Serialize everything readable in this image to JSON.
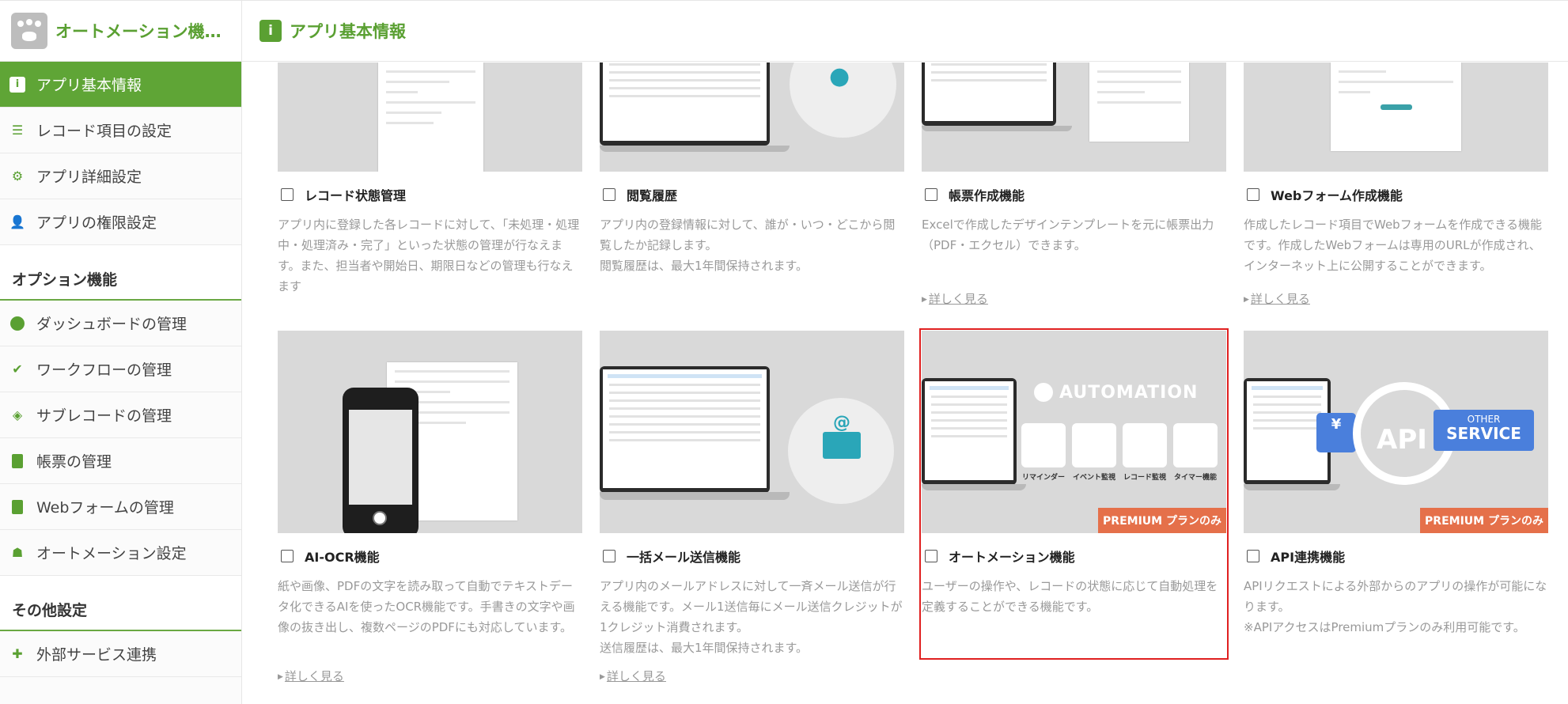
{
  "sidebar": {
    "app_name": "オートメーション機…",
    "main_items": [
      {
        "label": "アプリ基本情報",
        "icon": "info-icon",
        "active": true
      },
      {
        "label": "レコード項目の設定",
        "icon": "list-icon"
      },
      {
        "label": "アプリ詳細設定",
        "icon": "gear-icon"
      },
      {
        "label": "アプリの権限設定",
        "icon": "user-lock-icon"
      }
    ],
    "option_title": "オプション機能",
    "option_items": [
      {
        "label": "ダッシュボードの管理",
        "icon": "dashboard-icon"
      },
      {
        "label": "ワークフローの管理",
        "icon": "workflow-icon"
      },
      {
        "label": "サブレコードの管理",
        "icon": "layers-icon"
      },
      {
        "label": "帳票の管理",
        "icon": "excel-file-icon"
      },
      {
        "label": "Webフォームの管理",
        "icon": "clipboard-icon"
      },
      {
        "label": "オートメーション設定",
        "icon": "robot-icon"
      }
    ],
    "other_title": "その他設定",
    "other_items": [
      {
        "label": "外部サービス連携",
        "icon": "puzzle-icon"
      }
    ]
  },
  "header": {
    "title": "アプリ基本情報",
    "icon": "info-icon"
  },
  "cards": [
    {
      "title": "レコード状態管理",
      "desc": "アプリ内に登録した各レコードに対して、「未処理・処理中・処理済み・完了」といった状態の管理が行なえます。また、担当者や開始日、期限日などの管理も行なえます",
      "more": ""
    },
    {
      "title": "閲覧履歴",
      "desc": "アプリ内の登録情報に対して、誰が・いつ・どこから閲覧したか記録します。",
      "desc2": "閲覧履歴は、最大1年間保持されます。",
      "more": ""
    },
    {
      "title": "帳票作成機能",
      "desc": "Excelで作成したデザインテンプレートを元に帳票出力（PDF・エクセル）できます。",
      "more": "詳しく見る"
    },
    {
      "title": "Webフォーム作成機能",
      "desc": "作成したレコード項目でWebフォームを作成できる機能です。作成したWebフォームは専用のURLが作成され、インターネット上に公開することができます。",
      "more": "詳しく見る"
    },
    {
      "title": "AI-OCR機能",
      "desc": "紙や画像、PDFの文字を読み取って自動でテキストデータ化できるAIを使ったOCR機能です。手書きの文字や画像の抜き出し、複数ページのPDFにも対応しています。",
      "more": "詳しく見る"
    },
    {
      "title": "一括メール送信機能",
      "desc": "アプリ内のメールアドレスに対して一斉メール送信が行える機能です。メール1送信毎にメール送信クレジットが1クレジット消費されます。",
      "desc2": "送信履歴は、最大1年間保持されます。",
      "more": "詳しく見る"
    },
    {
      "title": "オートメーション機能",
      "desc": "ユーザーの操作や、レコードの状態に応じて自動処理を定義することができる機能です。",
      "badge": "PREMIUM プランのみ",
      "more": ""
    },
    {
      "title": "API連携機能",
      "desc": "APIリクエストによる外部からのアプリの操作が可能になります。",
      "desc2": "※APIアクセスはPremiumプランのみ利用可能です。",
      "badge": "PREMIUM プランのみ",
      "more": ""
    }
  ],
  "art": {
    "automation_label": "AUTOMATION",
    "automation_items": [
      "リマインダー",
      "イベント監視",
      "レコード監視",
      "タイマー機能"
    ],
    "api_label": "API",
    "other_service_top": "OTHER",
    "other_service_bottom": "SERVICE"
  },
  "colors": {
    "brand_green": "#5fa536",
    "premium_orange": "#e5704a",
    "highlight_red": "#e02020",
    "api_blue": "#4a7fdc"
  }
}
